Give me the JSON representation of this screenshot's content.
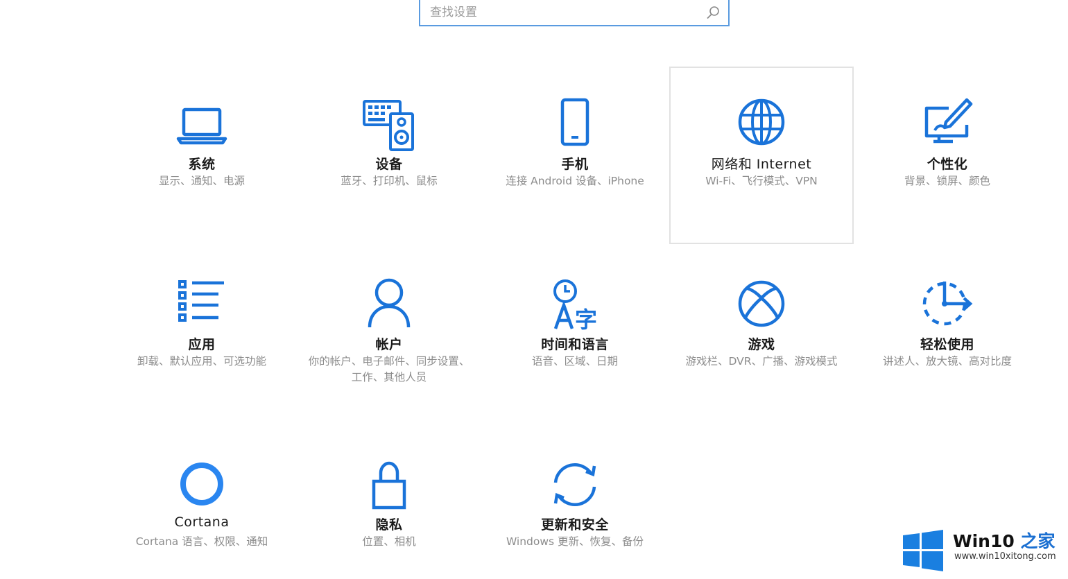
{
  "search": {
    "placeholder": "查找设置",
    "icon": "search-icon"
  },
  "colors": {
    "accent": "#1a73d9",
    "title": "#1a1a1a",
    "desc": "#8c8c8c",
    "selected_border": "#e2e2e2"
  },
  "tiles": [
    {
      "icon": "laptop-icon",
      "title": "系统",
      "desc": "显示、通知、电源"
    },
    {
      "icon": "keyboard-speaker-icon",
      "title": "设备",
      "desc": "蓝牙、打印机、鼠标"
    },
    {
      "icon": "phone-icon",
      "title": "手机",
      "desc": "连接 Android 设备、iPhone"
    },
    {
      "icon": "globe-icon",
      "title": "网络和 Internet",
      "desc": "Wi-Fi、飞行模式、VPN"
    },
    {
      "icon": "paint-monitor-icon",
      "title": "个性化",
      "desc": "背景、锁屏、颜色"
    },
    {
      "icon": "apps-list-icon",
      "title": "应用",
      "desc": "卸载、默认应用、可选功能"
    },
    {
      "icon": "person-icon",
      "title": "帐户",
      "desc": "你的帐户、电子邮件、同步设置、工作、其他人员"
    },
    {
      "icon": "time-language-icon",
      "title": "时间和语言",
      "desc": "语音、区域、日期"
    },
    {
      "icon": "xbox-icon",
      "title": "游戏",
      "desc": "游戏栏、DVR、广播、游戏模式"
    },
    {
      "icon": "ease-of-access-icon",
      "title": "轻松使用",
      "desc": "讲述人、放大镜、高对比度"
    },
    {
      "icon": "cortana-icon",
      "title": "Cortana",
      "desc": "Cortana 语言、权限、通知"
    },
    {
      "icon": "lock-icon",
      "title": "隐私",
      "desc": "位置、相机"
    },
    {
      "icon": "sync-icon",
      "title": "更新和安全",
      "desc": "Windows 更新、恢复、备份"
    }
  ],
  "watermark": {
    "brand_prefix": "Win10 ",
    "brand_accent": "之家",
    "url": "www.win10xitong.com",
    "icon": "windows-logo-icon"
  }
}
